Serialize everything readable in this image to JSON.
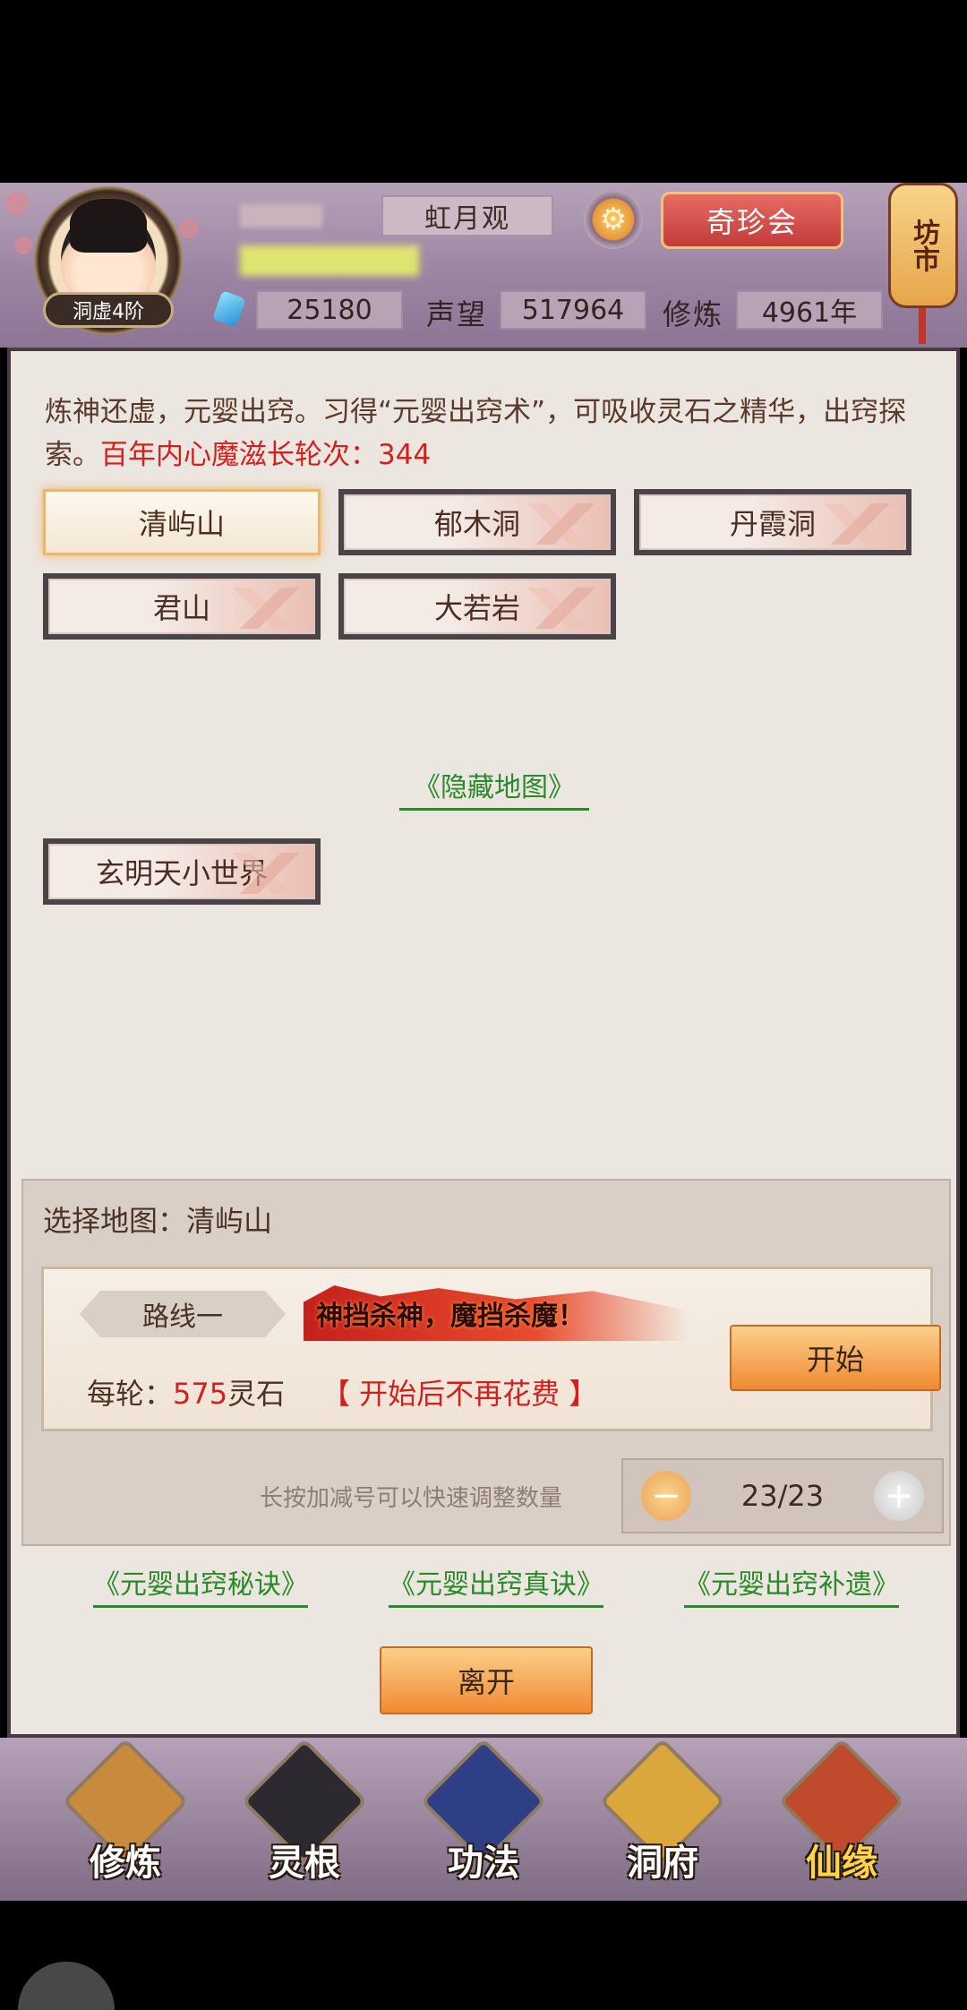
{
  "header": {
    "avatar_rank": "洞虚4阶",
    "sect": "虹月观",
    "treasure_button": "奇珍会",
    "market_lantern": "坊市",
    "spirit_stones": "25180",
    "reputation_label": "声望",
    "reputation": "517964",
    "cultivation_label": "修炼",
    "cultivation": "4961年"
  },
  "intro": {
    "text": "炼神还虚，元婴出窍。习得“元婴出窍术”，可吸收灵石之精华，出窍探索。",
    "red_text": "百年内心魔滋长轮次：344"
  },
  "maps": [
    "清屿山",
    "郁木洞",
    "丹霞洞",
    "君山",
    "大若岩"
  ],
  "hidden_map_link": "《隐藏地图》",
  "hidden_maps": [
    "玄明天小世界"
  ],
  "selection": {
    "title": "选择地图：清屿山",
    "route_label": "路线一",
    "banner": "神挡杀神，魔挡杀魔！",
    "cost_prefix": "每轮：",
    "cost_value": "575",
    "cost_unit": "灵石",
    "no_fee": "【 开始后不再花费 】",
    "start_button": "开始",
    "hint": "长按加减号可以快速调整数量",
    "count": "23/23"
  },
  "links": [
    "《元婴出窍秘诀》",
    "《元婴出窍真诀》",
    "《元婴出窍补遗》"
  ],
  "leave_button": "离开",
  "nav": [
    "修炼",
    "灵根",
    "功法",
    "洞府",
    "仙缘"
  ],
  "icons": {
    "gear": "gear-icon",
    "gem": "spirit-stone-icon",
    "minus": "minus-icon",
    "plus": "plus-icon"
  },
  "colors": {
    "accent_red": "#d41f1f",
    "link_green": "#2a8a2a",
    "button_orange": "#f08a33"
  }
}
